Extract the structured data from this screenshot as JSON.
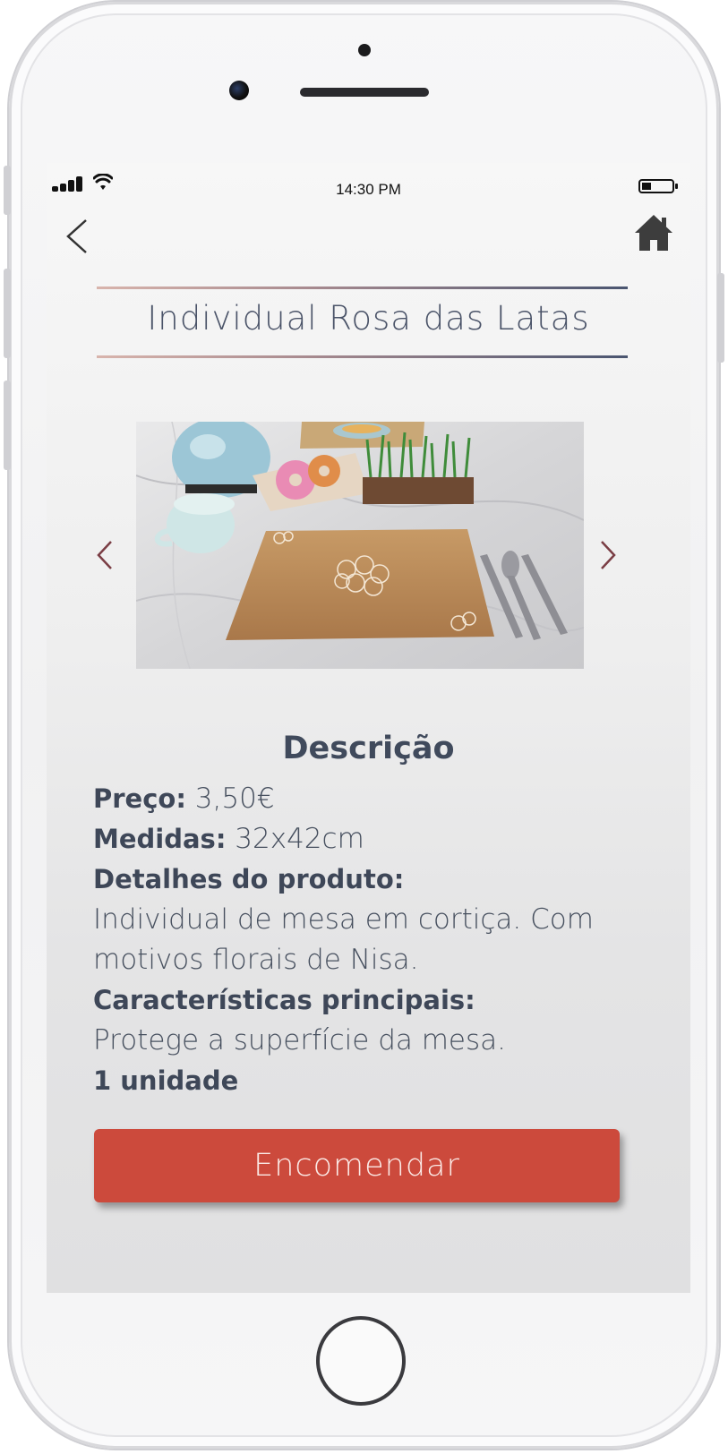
{
  "status_bar": {
    "time": "14:30 PM"
  },
  "nav": {
    "back_icon": "chevron-left-icon",
    "home_icon": "home-icon"
  },
  "product": {
    "title": "Individual Rosa das Latas"
  },
  "carousel": {
    "prev_icon": "chevron-left-icon",
    "next_icon": "chevron-right-icon"
  },
  "description": {
    "heading": "Descrição",
    "price_label": "Preço:",
    "price_value": "3,50€",
    "measures_label": "Medidas:",
    "measures_value": "32x42cm",
    "details_label": "Detalhes do produto:",
    "details_line1": "Individual de mesa em cortiça. Com",
    "details_line2": "motivos florais de Nisa.",
    "features_label": "Características principais:",
    "features_value": "Protege a superfície da mesa.",
    "quantity": "1 unidade"
  },
  "actions": {
    "order_label": "Encomendar"
  },
  "colors": {
    "accent_button": "#cc4a3c",
    "text_dark": "#404a5c",
    "title_rule_start": "#d8b4ac",
    "title_rule_end": "#4a5570",
    "arrow": "#7a3d44"
  }
}
